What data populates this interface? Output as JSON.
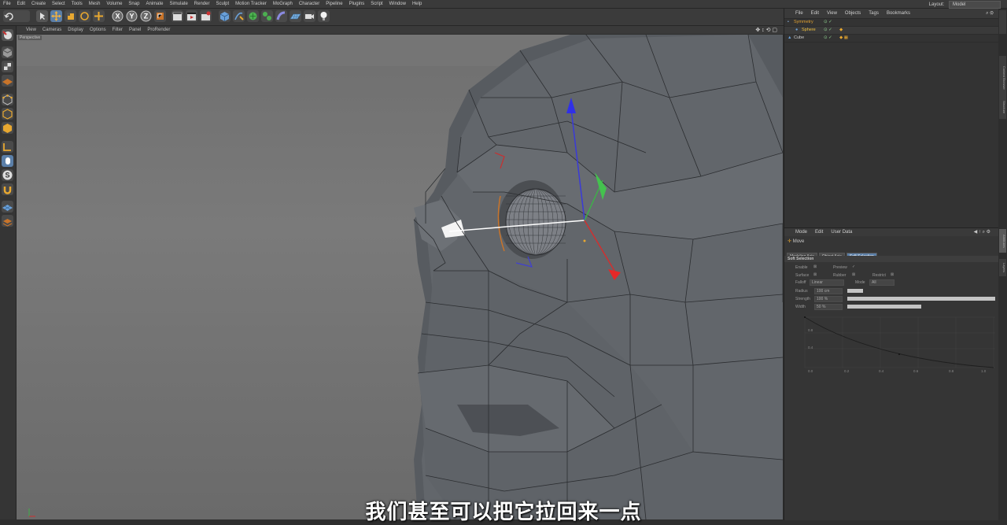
{
  "menubar": {
    "items": [
      "File",
      "Edit",
      "Create",
      "Select",
      "Tools",
      "Mesh",
      "Volume",
      "Snap",
      "Animate",
      "Simulate",
      "Render",
      "Sculpt",
      "Motion Tracker",
      "MoGraph",
      "Character",
      "Pipeline",
      "Plugins",
      "Script",
      "Window",
      "Help"
    ],
    "layout_label": "Layout:",
    "layout_value": "Model"
  },
  "toolbar": {
    "axis_x": "X",
    "axis_y": "Y",
    "axis_z": "Z"
  },
  "viewport": {
    "menu": [
      "View",
      "Cameras",
      "Display",
      "Options",
      "Filter",
      "Panel",
      "ProRender"
    ],
    "camera_label": "Perspective"
  },
  "objects": {
    "menu": [
      "File",
      "Edit",
      "View",
      "Objects",
      "Tags",
      "Bookmarks"
    ],
    "rows": [
      {
        "name": "Symmetry",
        "color": "#e0a030"
      },
      {
        "name": "Sphere",
        "color": "#f0c040"
      },
      {
        "name": "Cube",
        "color": "#cfcfcf"
      }
    ]
  },
  "attributes": {
    "menu": [
      "Mode",
      "Edit",
      "User Data"
    ],
    "tool_name": "Move",
    "tabs": [
      "Modeling Axis",
      "Object Axis",
      "Soft Selection"
    ],
    "section": "Soft Selection",
    "fields": {
      "enable": "Enable",
      "preview": "Preview",
      "surface": "Surface",
      "rubber": "Rubber",
      "restrict": "Restrict",
      "falloff": "Falloff",
      "falloff_value": "Linear",
      "mode": "Mode",
      "mode_value": "All",
      "radius": "Radius",
      "radius_value": "100 cm",
      "strength": "Strength",
      "strength_value": "100 %",
      "width": "Width",
      "width_value": "50 %"
    },
    "graph_y_labels": [
      "0.8",
      "0.4"
    ],
    "graph_x_labels": [
      "0.0",
      "0.2",
      "0.4",
      "0.6",
      "0.8",
      "1.0"
    ]
  },
  "side_tabs": [
    "Attributes",
    "Layers",
    "Content Browser",
    "Structure"
  ],
  "subtitle": "我们甚至可以把它拉回来一点"
}
